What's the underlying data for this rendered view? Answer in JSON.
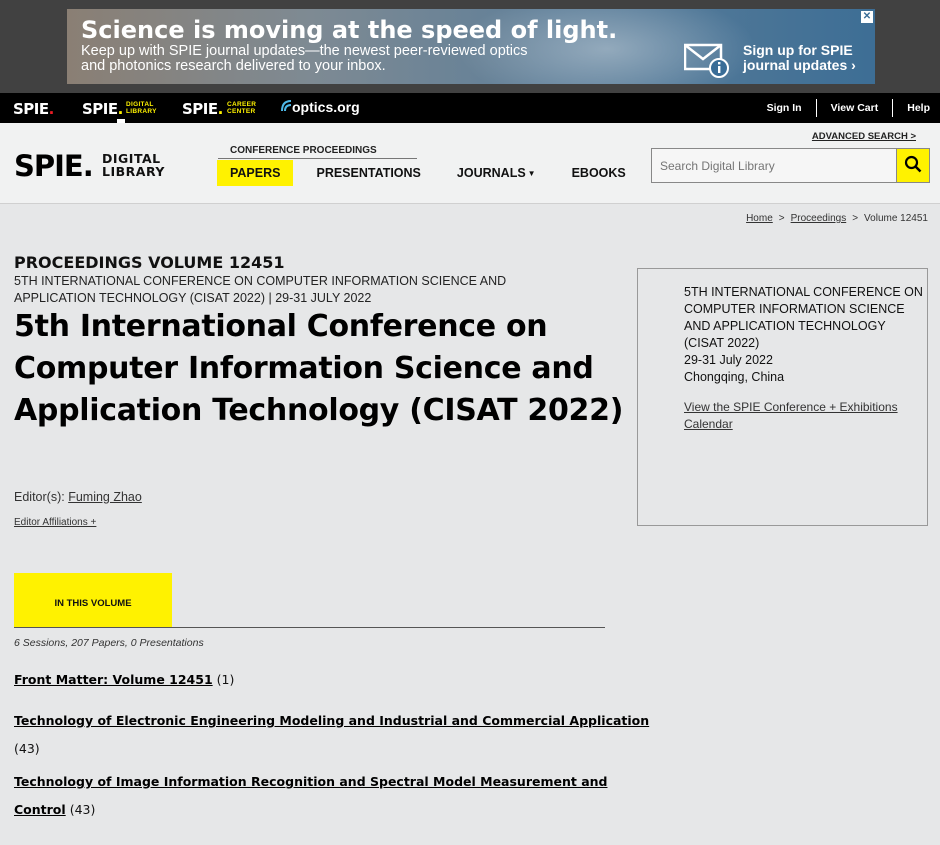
{
  "ad": {
    "headline": "Science is moving at the speed of light.",
    "subtext": "Keep up with SPIE journal updates—the newest peer-reviewed optics and photonics research delivered to your inbox.",
    "cta": "Sign up for SPIE journal updates ›",
    "close": "✕"
  },
  "topnav": {
    "brands": [
      {
        "name": "SPIE",
        "sub": ""
      },
      {
        "name": "SPIE",
        "sub_line1": "DIGITAL",
        "sub_line2": "LIBRARY"
      },
      {
        "name": "SPIE",
        "sub_line1": "CAREER",
        "sub_line2": "CENTER"
      },
      {
        "name": "optics.org"
      }
    ],
    "links": [
      "Sign In",
      "View Cart",
      "Help"
    ]
  },
  "header": {
    "logo": "SPIE",
    "logo_sub_line1": "DIGITAL",
    "logo_sub_line2": "LIBRARY",
    "conference_label": "CONFERENCE PROCEEDINGS",
    "nav": [
      "PAPERS",
      "PRESENTATIONS",
      "JOURNALS",
      "EBOOKS"
    ],
    "advanced_search": "ADVANCED SEARCH >",
    "search_placeholder": "Search Digital Library"
  },
  "breadcrumb": [
    "Home",
    "Proceedings",
    "Volume 12451"
  ],
  "main": {
    "volume": "PROCEEDINGS VOLUME 12451",
    "conference_line": "5TH INTERNATIONAL CONFERENCE ON COMPUTER INFORMATION SCIENCE AND APPLICATION TECHNOLOGY (CISAT 2022) | 29-31 JULY 2022",
    "title": "5th International Conference on Computer Information Science and Application Technology (CISAT 2022)",
    "editors_label": "Editor(s):",
    "editor": "Fuming Zhao",
    "affiliations": "Editor Affiliations +",
    "tab": "IN THIS VOLUME",
    "counts": "6 Sessions, 207 Papers, 0 Presentations",
    "sessions": [
      {
        "title": "Front Matter: Volume 12451",
        "count": "(1)"
      },
      {
        "title": "Technology of Electronic Engineering Modeling and Industrial and Commercial Application",
        "count": "(43)"
      },
      {
        "title": "Technology of Image Information Recognition and Spectral Model Measurement and Control",
        "count": "(43)"
      }
    ]
  },
  "sidebox": {
    "conference": "5TH INTERNATIONAL CONFERENCE ON COMPUTER INFORMATION SCIENCE AND APPLICATION TECHNOLOGY (CISAT 2022)",
    "dates": "29-31 July 2022",
    "location": "Chongqing, China",
    "calendar_link": "View the SPIE Conference + Exhibitions Calendar"
  },
  "colors": {
    "accent_yellow": "#fff200",
    "brand_red": "#ed1c24",
    "nav_black": "#000000",
    "page_bg": "#e6e7e8"
  },
  "icons": [
    "mail-info-icon",
    "close-icon",
    "search-icon",
    "chevron-down-icon",
    "optics-wave-icon"
  ]
}
